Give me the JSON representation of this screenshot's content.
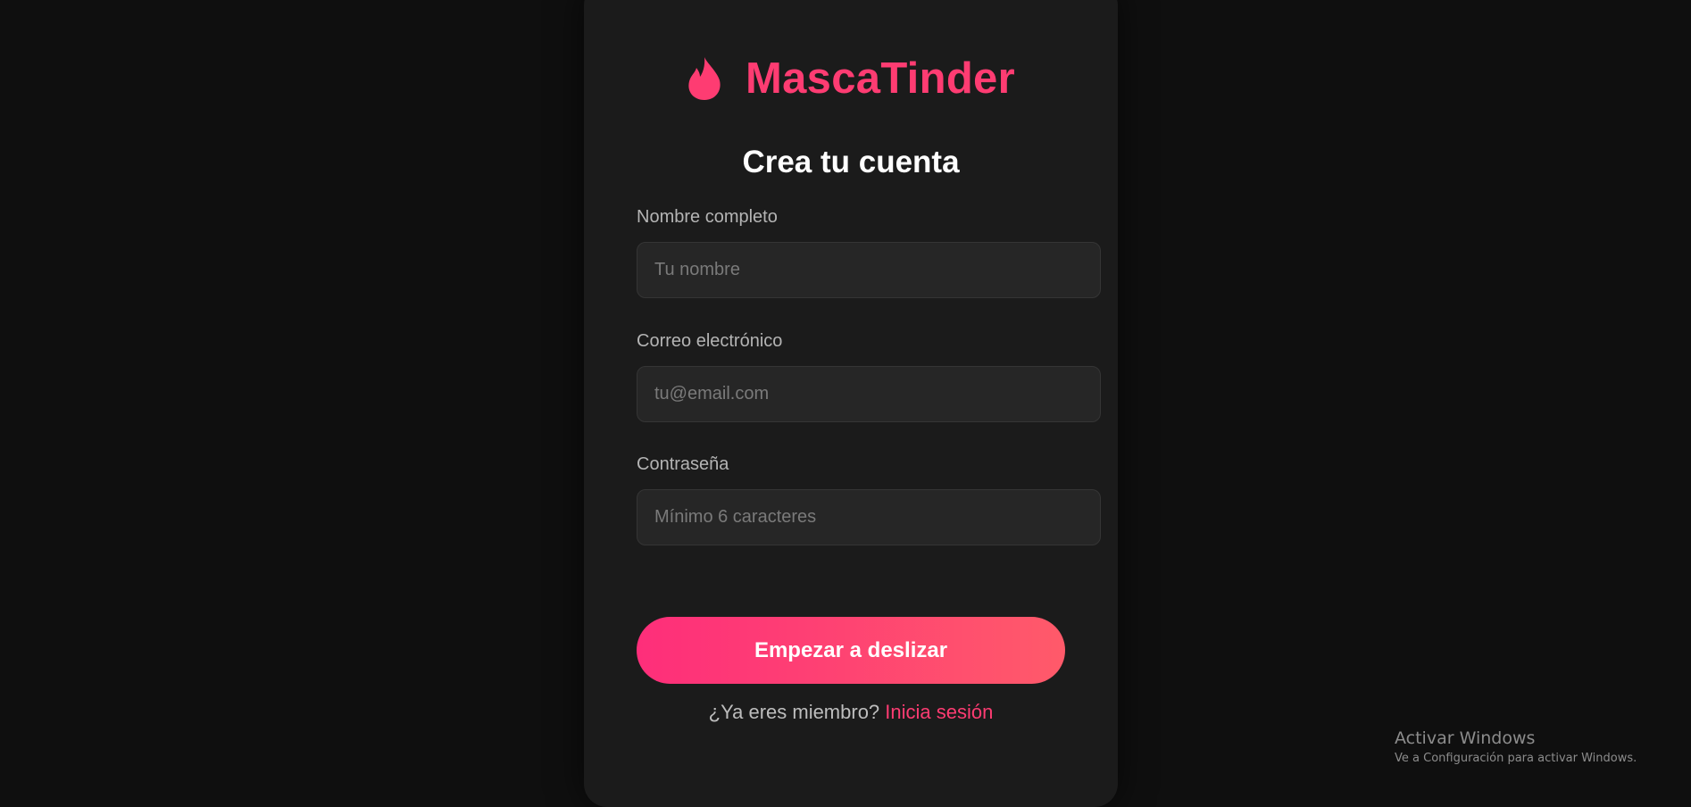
{
  "brand": {
    "name": "MascaTinder",
    "icon": "flame-icon",
    "color": "#fe3c72"
  },
  "form": {
    "heading": "Crea tu cuenta",
    "fields": [
      {
        "label": "Nombre completo",
        "placeholder": "Tu nombre",
        "value": ""
      },
      {
        "label": "Correo electrónico",
        "placeholder": "tu@email.com",
        "value": ""
      },
      {
        "label": "Contraseña",
        "placeholder": "Mínimo 6 caracteres",
        "value": ""
      }
    ],
    "submit_label": "Empezar a deslizar",
    "submit_gradient": [
      "#fe2e7a",
      "#ff5a6a"
    ]
  },
  "footer": {
    "prompt": "¿Ya eres miembro? ",
    "link": "Inicia sesión"
  },
  "watermark": {
    "title": "Activar Windows",
    "subtitle": "Ve a Configuración para activar Windows."
  }
}
